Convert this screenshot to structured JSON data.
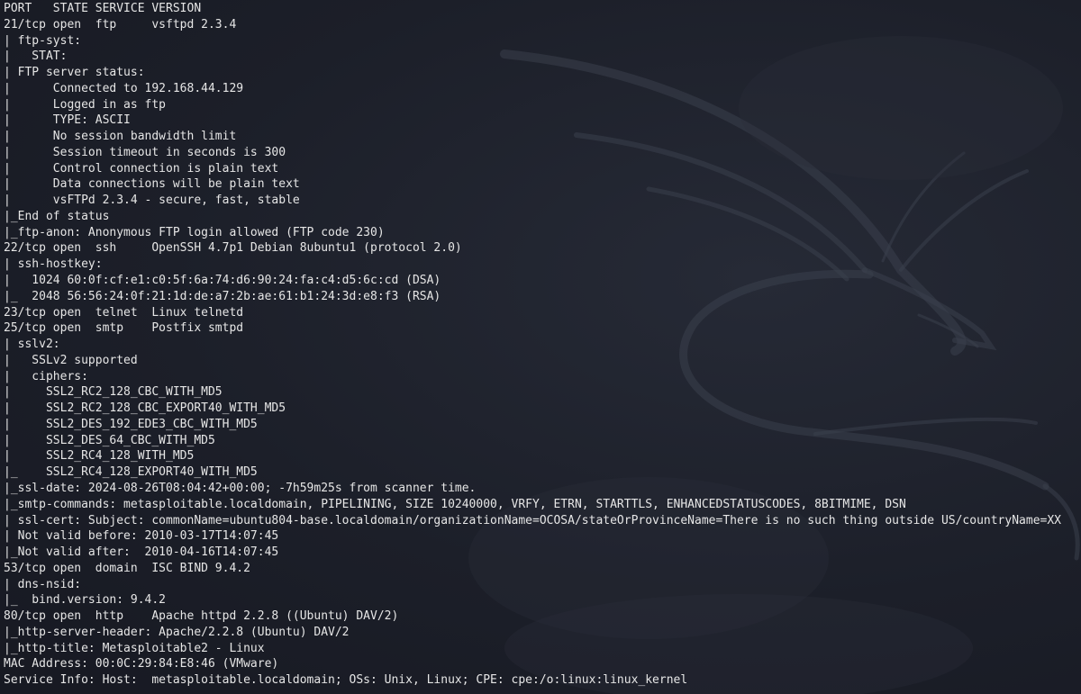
{
  "terminal": {
    "background_color": "#1c1f29",
    "text_color": "#e6e6e6",
    "background_logo": "kali-dragon-logo",
    "lines": [
      "PORT   STATE SERVICE VERSION",
      "21/tcp open  ftp     vsftpd 2.3.4",
      "| ftp-syst: ",
      "|   STAT: ",
      "| FTP server status:",
      "|      Connected to 192.168.44.129",
      "|      Logged in as ftp",
      "|      TYPE: ASCII",
      "|      No session bandwidth limit",
      "|      Session timeout in seconds is 300",
      "|      Control connection is plain text",
      "|      Data connections will be plain text",
      "|      vsFTPd 2.3.4 - secure, fast, stable",
      "|_End of status",
      "|_ftp-anon: Anonymous FTP login allowed (FTP code 230)",
      "22/tcp open  ssh     OpenSSH 4.7p1 Debian 8ubuntu1 (protocol 2.0)",
      "| ssh-hostkey: ",
      "|   1024 60:0f:cf:e1:c0:5f:6a:74:d6:90:24:fa:c4:d5:6c:cd (DSA)",
      "|_  2048 56:56:24:0f:21:1d:de:a7:2b:ae:61:b1:24:3d:e8:f3 (RSA)",
      "23/tcp open  telnet  Linux telnetd",
      "25/tcp open  smtp    Postfix smtpd",
      "| sslv2: ",
      "|   SSLv2 supported",
      "|   ciphers: ",
      "|     SSL2_RC2_128_CBC_WITH_MD5",
      "|     SSL2_RC2_128_CBC_EXPORT40_WITH_MD5",
      "|     SSL2_DES_192_EDE3_CBC_WITH_MD5",
      "|     SSL2_DES_64_CBC_WITH_MD5",
      "|     SSL2_RC4_128_WITH_MD5",
      "|_    SSL2_RC4_128_EXPORT40_WITH_MD5",
      "|_ssl-date: 2024-08-26T08:04:42+00:00; -7h59m25s from scanner time.",
      "|_smtp-commands: metasploitable.localdomain, PIPELINING, SIZE 10240000, VRFY, ETRN, STARTTLS, ENHANCEDSTATUSCODES, 8BITMIME, DSN",
      "| ssl-cert: Subject: commonName=ubuntu804-base.localdomain/organizationName=OCOSA/stateOrProvinceName=There is no such thing outside US/countryName=XX",
      "| Not valid before: 2010-03-17T14:07:45",
      "|_Not valid after:  2010-04-16T14:07:45",
      "53/tcp open  domain  ISC BIND 9.4.2",
      "| dns-nsid: ",
      "|_  bind.version: 9.4.2",
      "80/tcp open  http    Apache httpd 2.2.8 ((Ubuntu) DAV/2)",
      "|_http-server-header: Apache/2.2.8 (Ubuntu) DAV/2",
      "|_http-title: Metasploitable2 - Linux",
      "MAC Address: 00:0C:29:84:E8:46 (VMware)",
      "Service Info: Host:  metasploitable.localdomain; OSs: Unix, Linux; CPE: cpe:/o:linux:linux_kernel"
    ]
  }
}
